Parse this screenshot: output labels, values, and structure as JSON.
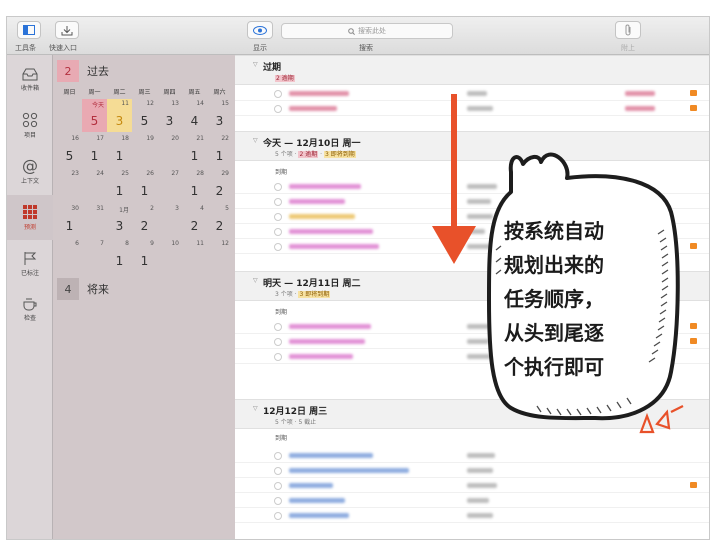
{
  "toolbar": {
    "toolbar_label": "工具条",
    "quick_entry_label": "快速入口",
    "view_label": "显示",
    "search_label": "搜索",
    "search_placeholder": "搜索此处",
    "attach_label": "附上"
  },
  "sidebar": {
    "items": [
      {
        "label": "收件箱",
        "icon": "inbox-icon"
      },
      {
        "label": "项目",
        "icon": "projects-icon"
      },
      {
        "label": "上下文",
        "icon": "at-icon"
      },
      {
        "label": "预测",
        "icon": "forecast-icon"
      },
      {
        "label": "已标注",
        "icon": "flag-icon"
      },
      {
        "label": "检查",
        "icon": "review-icon"
      }
    ],
    "active": "预测",
    "accent": "#c0392b"
  },
  "calendar": {
    "past_count": "2",
    "past_label": "过去",
    "weekdays": [
      "周日",
      "周一",
      "周二",
      "周三",
      "周四",
      "周五",
      "周六"
    ],
    "cells": [
      {
        "small": "",
        "big": ""
      },
      {
        "small": "今天",
        "big": "5",
        "type": "today"
      },
      {
        "small": "11",
        "big": "3",
        "type": "next"
      },
      {
        "small": "12",
        "big": "5"
      },
      {
        "small": "13",
        "big": "3"
      },
      {
        "small": "14",
        "big": "4"
      },
      {
        "small": "15",
        "big": "3"
      },
      {
        "small": "16",
        "big": "5"
      },
      {
        "small": "17",
        "big": "1"
      },
      {
        "small": "18",
        "big": "1"
      },
      {
        "small": "19",
        "big": ""
      },
      {
        "small": "20",
        "big": ""
      },
      {
        "small": "21",
        "big": "1"
      },
      {
        "small": "22",
        "big": "1"
      },
      {
        "small": "23",
        "big": ""
      },
      {
        "small": "24",
        "big": ""
      },
      {
        "small": "25",
        "big": "1"
      },
      {
        "small": "26",
        "big": "1"
      },
      {
        "small": "27",
        "big": ""
      },
      {
        "small": "28",
        "big": "1"
      },
      {
        "small": "29",
        "big": "2"
      },
      {
        "small": "30",
        "big": "1"
      },
      {
        "small": "31",
        "big": ""
      },
      {
        "small": "1月",
        "big": "3"
      },
      {
        "small": "2",
        "big": "2"
      },
      {
        "small": "3",
        "big": ""
      },
      {
        "small": "4",
        "big": "2"
      },
      {
        "small": "5",
        "big": "2"
      },
      {
        "small": "6",
        "big": ""
      },
      {
        "small": "7",
        "big": ""
      },
      {
        "small": "8",
        "big": "1"
      },
      {
        "small": "9",
        "big": "1"
      },
      {
        "small": "10",
        "big": ""
      },
      {
        "small": "11",
        "big": ""
      },
      {
        "small": "12",
        "big": ""
      }
    ],
    "future_count": "4",
    "future_label": "将来"
  },
  "main": {
    "overdue": {
      "title": "过期",
      "badge": "2 逾期"
    },
    "today": {
      "title": "今天 — 12月10日 周一",
      "count": "5 个项 ·",
      "overdue": "2 逾期",
      "sep": "·",
      "due_soon": "3 即将到期",
      "group": "到期"
    },
    "tomorrow": {
      "title": "明天 — 12月11日 周二",
      "count": "3 个项 ·",
      "due_soon": "3 即将到期",
      "group": "到期"
    },
    "dec12": {
      "title": "12月12日 周三",
      "count": "5 个项 · 5 截止",
      "group": "到期"
    },
    "colors": {
      "red": "#f2c4cb",
      "yellow": "#f7e2a2",
      "blue": "#6b93d6",
      "pink": "#d96fc9",
      "flag": "#f08a24"
    }
  },
  "annotation": {
    "lines": [
      "按系统自动",
      "规划出来的",
      "任务顺序，",
      "从头到尾逐",
      "个执行即可"
    ],
    "arrow_color": "#e8512a"
  }
}
